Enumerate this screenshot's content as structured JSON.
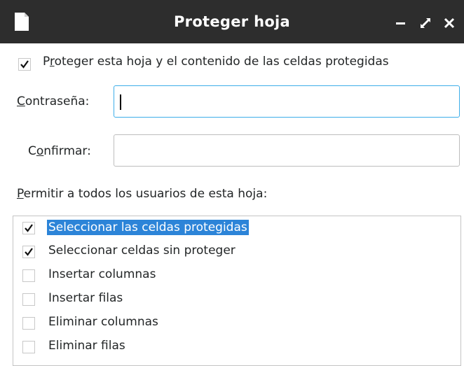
{
  "window": {
    "title": "Proteger hoja",
    "title_icon": "document-icon",
    "controls": [
      "minimize-icon",
      "maximize-icon",
      "close-icon"
    ]
  },
  "protect": {
    "checked": true,
    "label_pre": "P",
    "label_mnemonic": "r",
    "label_post": "oteger esta hoja y el contenido de las celdas protegidas"
  },
  "password": {
    "label_mnemonic": "C",
    "label_post": "ontraseña:",
    "value": ""
  },
  "confirm": {
    "label_pre": "C",
    "label_mnemonic": "o",
    "label_post": "nfirmar:",
    "value": ""
  },
  "permissions": {
    "heading_mnemonic": "P",
    "heading_post": "ermitir a todos los usuarios de esta hoja:",
    "items": [
      {
        "label": "Seleccionar las celdas protegidas",
        "checked": true,
        "selected": true
      },
      {
        "label": "Seleccionar celdas sin proteger",
        "checked": true,
        "selected": false
      },
      {
        "label": "Insertar columnas",
        "checked": false,
        "selected": false
      },
      {
        "label": "Insertar filas",
        "checked": false,
        "selected": false
      },
      {
        "label": "Eliminar columnas",
        "checked": false,
        "selected": false
      },
      {
        "label": "Eliminar filas",
        "checked": false,
        "selected": false
      }
    ]
  },
  "colors": {
    "titlebar": "#2d2d2d",
    "selection": "#2c84d8",
    "focus": "#3daee9"
  }
}
